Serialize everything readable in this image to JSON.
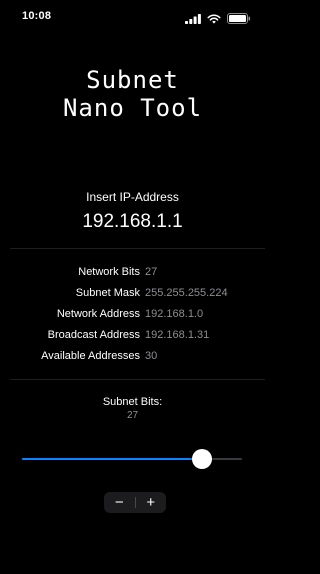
{
  "status_bar": {
    "time": "10:08"
  },
  "title": {
    "line1": "Subnet",
    "line2": "Nano Tool"
  },
  "ip": {
    "label": "Insert IP-Address",
    "value": "192.168.1.1"
  },
  "info": [
    {
      "key": "Network Bits",
      "value": "27"
    },
    {
      "key": "Subnet Mask",
      "value": "255.255.255.224"
    },
    {
      "key": "Network Address",
      "value": "192.168.1.0"
    },
    {
      "key": "Broadcast Address",
      "value": "192.168.1.31"
    },
    {
      "key": "Available Addresses",
      "value": "30"
    }
  ],
  "subnet": {
    "label": "Subnet Bits:",
    "value": "27",
    "slider_fraction": 0.82
  },
  "stepper": {
    "minus": "−",
    "plus": "+"
  },
  "colors": {
    "accent": "#0a84ff",
    "background": "#000000",
    "secondary_text": "#8e8e93"
  },
  "icons": [
    "cellular-signal-icon",
    "wifi-icon",
    "battery-icon"
  ]
}
